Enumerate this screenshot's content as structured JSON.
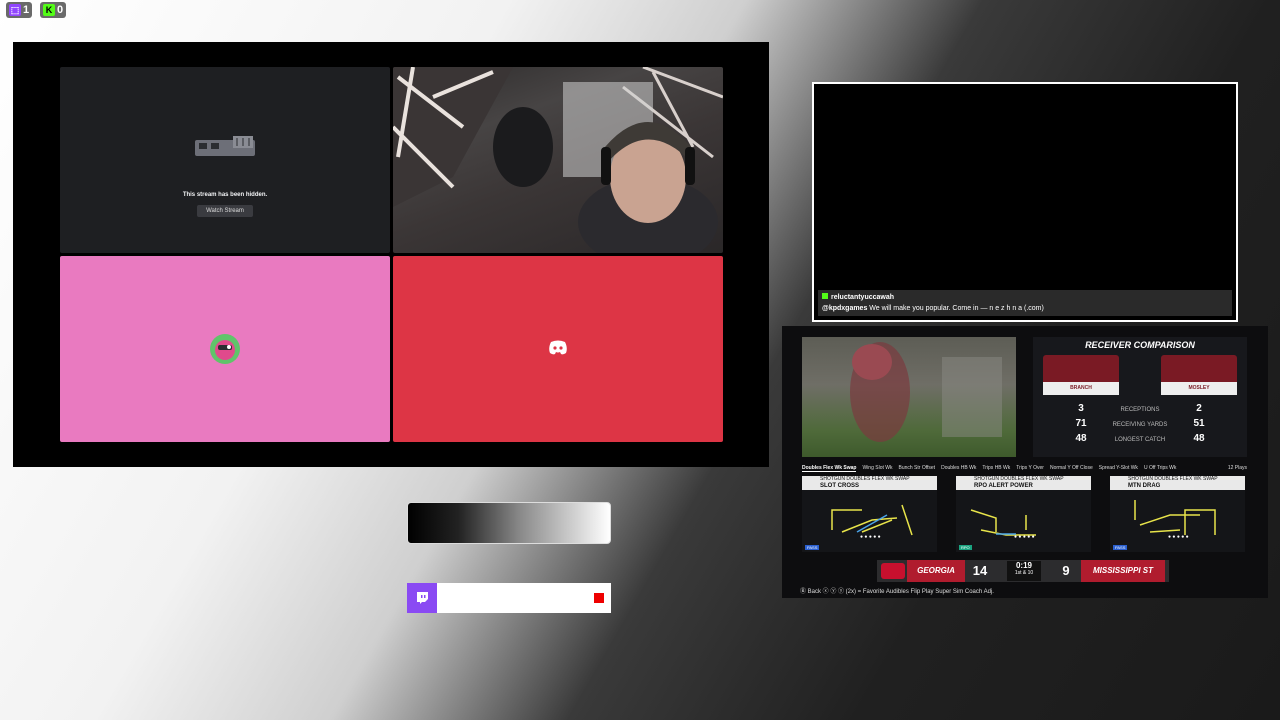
{
  "badges": {
    "twitch_count": "1",
    "kick_count": "0"
  },
  "call": {
    "hidden_text": "This stream has been hidden.",
    "watch_label": "Watch Stream"
  },
  "chat": {
    "user1": "reluctantyuccawah",
    "user2": "@kpdxgames",
    "msg2": "We will make you popular. Come in — n e z h n a (.com)"
  },
  "game": {
    "comparison_title": "RECEIVER COMPARISON",
    "left_player": "BRANCH",
    "right_player": "MOSLEY",
    "stats": [
      {
        "left": "3",
        "label": "RECEPTIONS",
        "right": "2"
      },
      {
        "left": "71",
        "label": "RECEIVING YARDS",
        "right": "51"
      },
      {
        "left": "48",
        "label": "LONGEST CATCH",
        "right": "48"
      }
    ],
    "formation_tabs": [
      "Doubles Flex Wk Swap",
      "Wing Slot Wk",
      "Bunch Str Offset",
      "Doubles HB Wk",
      "Trips HB Wk",
      "Trips Y Over",
      "Normal Y Off Close",
      "Spread Y-Slot Wk",
      "U Off Trips Wk"
    ],
    "plays_count": "12 Plays",
    "plays": [
      {
        "formation": "SHOTGUN DOUBLES FLEX WK SWAP",
        "name": "SLOT CROSS",
        "tag": "PASS"
      },
      {
        "formation": "SHOTGUN DOUBLES FLEX WK SWAP",
        "name": "RPO ALERT POWER",
        "tag": "RPO"
      },
      {
        "formation": "SHOTGUN DOUBLES FLEX WK SWAP",
        "name": "MTN DRAG",
        "tag": "PASS"
      }
    ],
    "home_team": "GEORGIA",
    "home_score": "14",
    "away_team": "MISSISSIPPI ST",
    "away_score": "9",
    "clock": "0:19",
    "down": "1st & 10",
    "hints": "Ⓑ Back   ⓧ ⓨ ⓨ (2x) = Favorite   Audibles   Flip Play   Super Sim   Coach Adj."
  },
  "colors": {
    "twitch": "#9146ff",
    "discord_red": "#dd3545",
    "pink": "#e97ac0"
  }
}
